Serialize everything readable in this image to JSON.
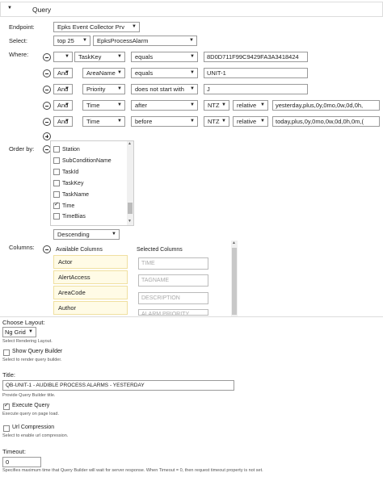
{
  "panel": {
    "title": "Query"
  },
  "endpoint": {
    "label": "Endpoint:",
    "value": "Epks Event Collector Prv"
  },
  "select": {
    "label": "Select:",
    "top": "top 25",
    "alarm": "EpksProcessAlarm"
  },
  "where": {
    "label": "Where:",
    "rows": [
      {
        "conj": "",
        "field": "TaskKey",
        "op": "equals",
        "value": "8D0D711F99C9429FA3A3418424"
      },
      {
        "conj": "And",
        "field": "AreaName",
        "op": "equals",
        "value": "UNIT-1"
      },
      {
        "conj": "And",
        "field": "Priority",
        "op": "does not start with",
        "value": "J"
      },
      {
        "conj": "And",
        "field": "Time",
        "op": "after",
        "tz": "NTZ",
        "mode": "relative",
        "value": "yesterday,plus,0y,0mo,0w,0d,0h,"
      },
      {
        "conj": "And",
        "field": "Time",
        "op": "before",
        "tz": "NTZ",
        "mode": "relative",
        "value": "today,plus,0y,0mo,0w,0d,0h,0m,("
      }
    ]
  },
  "orderBy": {
    "label": "Order by:",
    "items": [
      {
        "label": "Station",
        "checked": false
      },
      {
        "label": "SubConditionName",
        "checked": false
      },
      {
        "label": "TaskId",
        "checked": false
      },
      {
        "label": "TaskKey",
        "checked": false
      },
      {
        "label": "TaskName",
        "checked": false
      },
      {
        "label": "Time",
        "checked": true
      },
      {
        "label": "TimeBias",
        "checked": false
      }
    ],
    "direction": "Descending"
  },
  "columns": {
    "label": "Columns:",
    "availableTitle": "Available Columns",
    "selectedTitle": "Selected Columns",
    "available": [
      "Actor",
      "AlertAccess",
      "AreaCode",
      "Author"
    ],
    "selected": [
      "TIME",
      "TAGNAME",
      "DESCRIPTION",
      "ALARM PRIORITY"
    ]
  },
  "layout": {
    "label": "Choose Layout:",
    "value": "Ng Grid",
    "help": "Select Rendering Layout."
  },
  "showQB": {
    "label": "Show Query Builder",
    "help": "Select to render query builder.",
    "checked": false
  },
  "title": {
    "label": "Title:",
    "value": "QB-UNIT-1 - AUDIBLE PROCESS ALARMS - YESTERDAY",
    "help": "Provide Query Builder title."
  },
  "execute": {
    "label": "Execute Query",
    "help": "Execute query on page load.",
    "checked": true
  },
  "urlCompression": {
    "label": "Url Compression",
    "help": "Select to enable url compression.",
    "checked": false
  },
  "timeout": {
    "label": "Timeout:",
    "value": "0",
    "help": "Specifies maximum time that Query Builder will wait for server response. When Timeout = 0, then request timeout property is not set."
  }
}
